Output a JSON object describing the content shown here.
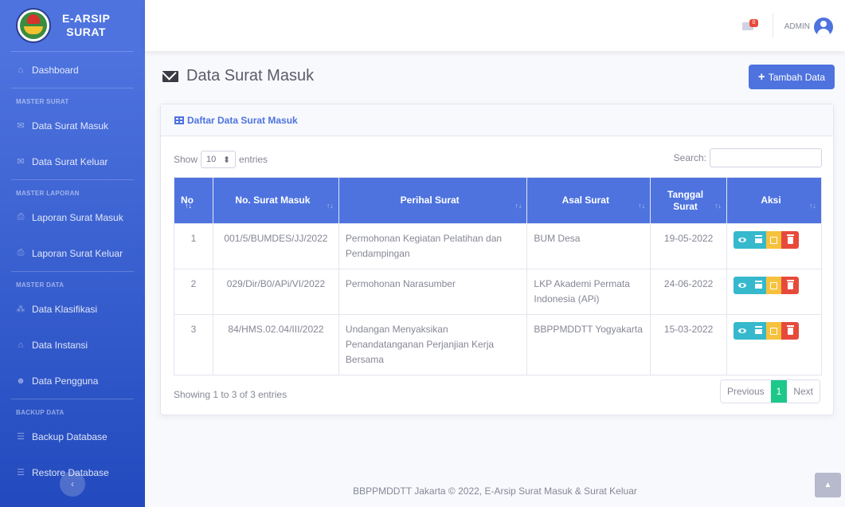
{
  "brand": {
    "line1": "E-ARSIP",
    "line2": "SURAT"
  },
  "sidebar": {
    "dashboard": "Dashboard",
    "sections": [
      {
        "heading": "MASTER SURAT",
        "items": [
          {
            "label": "Data Surat Masuk",
            "icon": "envelope-icon"
          },
          {
            "label": "Data Surat Keluar",
            "icon": "envelope-icon"
          }
        ]
      },
      {
        "heading": "MASTER LAPORAN",
        "items": [
          {
            "label": "Laporan Surat Masuk",
            "icon": "print-icon"
          },
          {
            "label": "Laporan Surat Keluar",
            "icon": "print-icon"
          }
        ]
      },
      {
        "heading": "MASTER DATA",
        "items": [
          {
            "label": "Data Klasifikasi",
            "icon": "sitemap-icon"
          },
          {
            "label": "Data Instansi",
            "icon": "building-icon"
          },
          {
            "label": "Data Pengguna",
            "icon": "users-icon"
          }
        ]
      },
      {
        "heading": "BACKUP DATA",
        "items": [
          {
            "label": "Backup Database",
            "icon": "database-icon"
          },
          {
            "label": "Restore Database",
            "icon": "database-icon"
          }
        ]
      }
    ],
    "toggle": "‹"
  },
  "topbar": {
    "badge": "0",
    "user": "ADMIN"
  },
  "page": {
    "title": "Data Surat Masuk",
    "add_button": "Tambah Data"
  },
  "card": {
    "title": "Daftar Data Surat Masuk",
    "show_label": "Show",
    "entries_value": "10",
    "entries_label": "entries",
    "search_label": "Search:",
    "columns": [
      "No",
      "No. Surat Masuk",
      "Perihal Surat",
      "Asal Surat",
      "Tanggal Surat",
      "Aksi"
    ],
    "rows": [
      {
        "no": "1",
        "nomor": "001/5/BUMDES/JJ/2022",
        "perihal": "Permohonan Kegiatan Pelatihan dan Pendampingan",
        "asal": "BUM Desa",
        "tanggal": "19-05-2022"
      },
      {
        "no": "2",
        "nomor": "029/Dir/B0/APi/VI/2022",
        "perihal": "Permohonan Narasumber",
        "asal": "LKP Akademi Permata Indonesia (APi)",
        "tanggal": "24-06-2022"
      },
      {
        "no": "3",
        "nomor": "84/HMS.02.04/III/2022",
        "perihal": "Undangan Menyaksikan Penandatanganan Perjanjian Kerja Bersama",
        "asal": "BBPPMDDTT Yogyakarta",
        "tanggal": "15-03-2022"
      }
    ],
    "info": "Showing 1 to 3 of 3 entries",
    "pager": {
      "prev": "Previous",
      "current": "1",
      "next": "Next"
    }
  },
  "footer": "BBPPMDDTT Jakarta © 2022, E-Arsip Surat Masuk & Surat Keluar",
  "colors": {
    "primary": "#4e73df",
    "info": "#36b9cc",
    "warning": "#f6c23e",
    "danger": "#e74a3b",
    "success": "#1cc88a"
  }
}
